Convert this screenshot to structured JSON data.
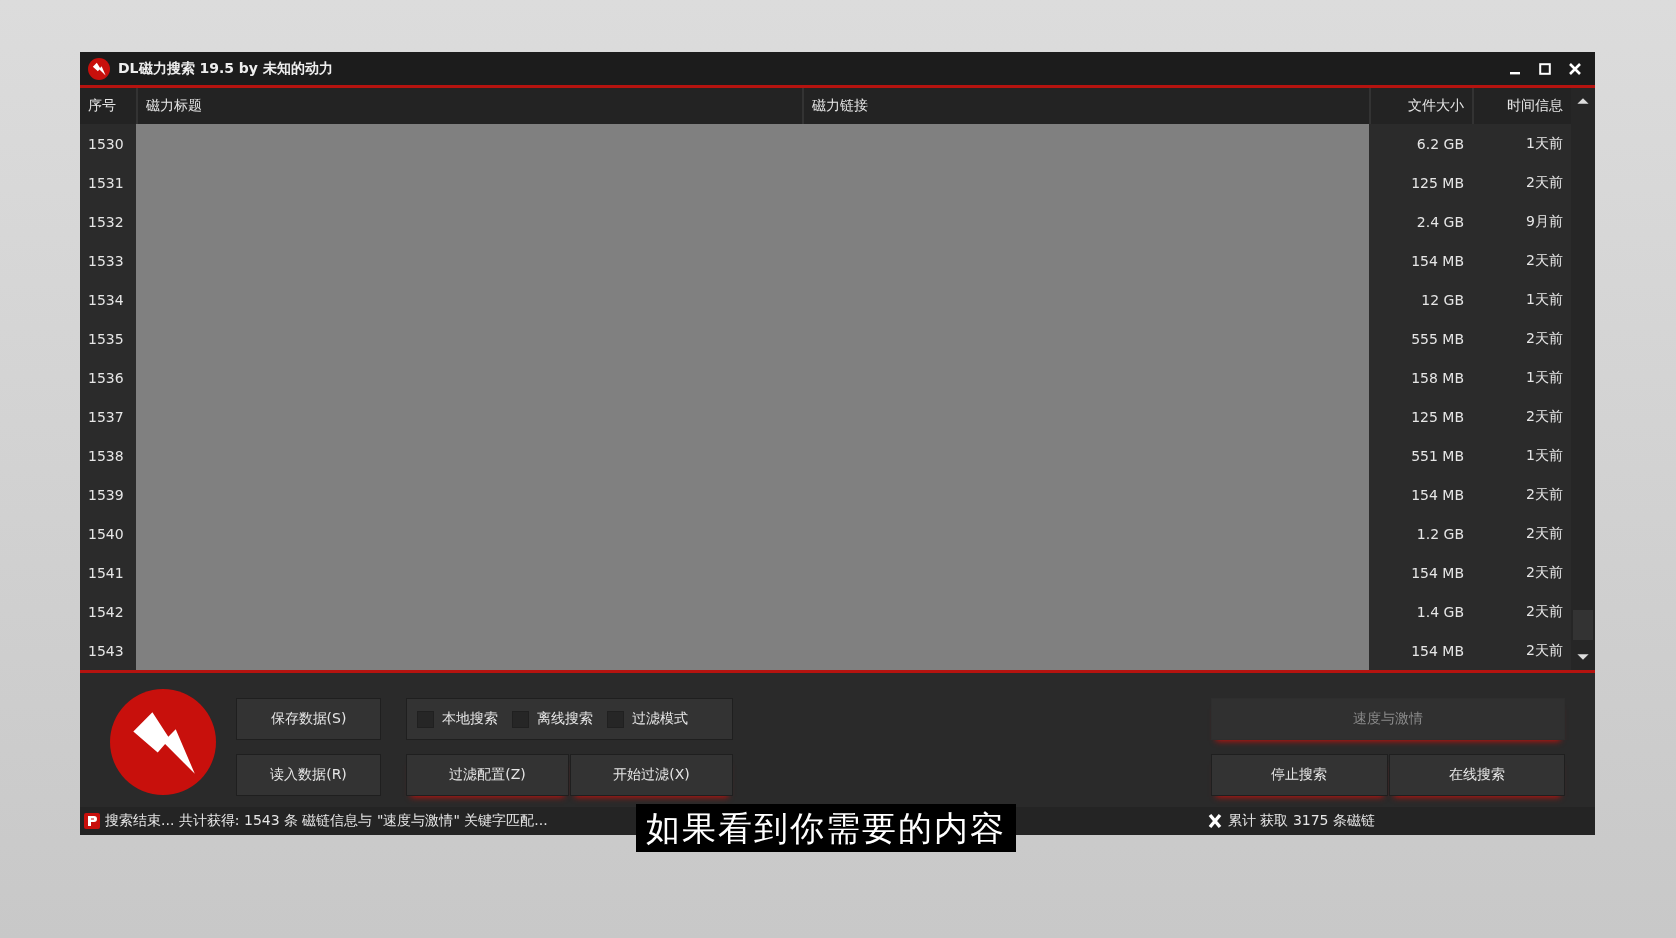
{
  "window": {
    "title": "DL磁力搜索 19.5 by 未知的动力"
  },
  "table": {
    "columns": [
      {
        "label": "序号"
      },
      {
        "label": "磁力标题"
      },
      {
        "label": "磁力链接"
      },
      {
        "label": "文件大小"
      },
      {
        "label": "时间信息"
      }
    ],
    "rows": [
      {
        "index": "1530",
        "size": "6.2 GB",
        "time": "1天前"
      },
      {
        "index": "1531",
        "size": "125 MB",
        "time": "2天前"
      },
      {
        "index": "1532",
        "size": "2.4 GB",
        "time": "9月前"
      },
      {
        "index": "1533",
        "size": "154 MB",
        "time": "2天前"
      },
      {
        "index": "1534",
        "size": "12 GB",
        "time": "1天前"
      },
      {
        "index": "1535",
        "size": "555 MB",
        "time": "2天前"
      },
      {
        "index": "1536",
        "size": "158 MB",
        "time": "1天前"
      },
      {
        "index": "1537",
        "size": "125 MB",
        "time": "2天前"
      },
      {
        "index": "1538",
        "size": "551 MB",
        "time": "1天前"
      },
      {
        "index": "1539",
        "size": "154 MB",
        "time": "2天前"
      },
      {
        "index": "1540",
        "size": "1.2 GB",
        "time": "2天前"
      },
      {
        "index": "1541",
        "size": "154 MB",
        "time": "2天前"
      },
      {
        "index": "1542",
        "size": "1.4 GB",
        "time": "2天前"
      },
      {
        "index": "1543",
        "size": "154 MB",
        "time": "2天前"
      }
    ]
  },
  "left_buttons": [
    "保存数据(S)",
    "读入数据(R)"
  ],
  "options": [
    {
      "label": "本地搜索",
      "checked": false
    },
    {
      "label": "离线搜索",
      "checked": false
    },
    {
      "label": "过滤模式",
      "checked": false
    }
  ],
  "filter_buttons": [
    "过滤配置(Z)",
    "开始过滤(X)"
  ],
  "search_field": {
    "value": "速度与激情"
  },
  "search_buttons": [
    "停止搜索",
    "在线搜索"
  ],
  "status_bar": {
    "left": "搜索结束... 共计获得:  1543 条 磁链信息与 \"速度与激情\" 关键字匹配...",
    "right": "累计 获取 3175 条磁链"
  },
  "subtitle": "如果看到你需要的内容"
}
